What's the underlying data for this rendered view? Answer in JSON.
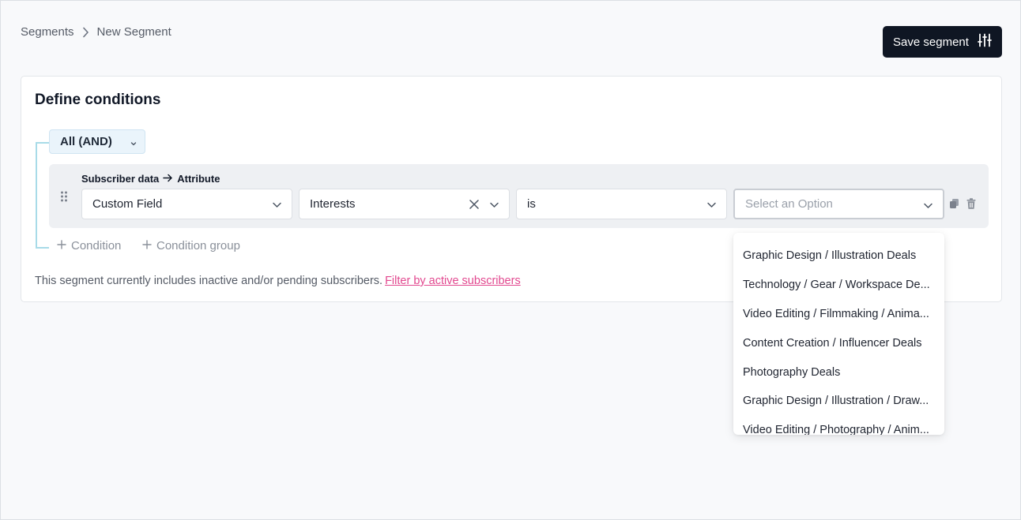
{
  "breadcrumb": {
    "parent": "Segments",
    "current": "New Segment"
  },
  "save_button": {
    "label": "Save segment",
    "icon": "sliders-icon"
  },
  "card": {
    "title": "Define conditions",
    "logic_operator": "All (AND)",
    "condition": {
      "source_label": "Subscriber data",
      "arrow": "→",
      "target_label": "Attribute",
      "field_type": "Custom Field",
      "field": "Interests",
      "operator": "is",
      "value_placeholder": "Select an Option"
    },
    "add_condition_label": "Condition",
    "add_group_label": "Condition group",
    "note": "This segment currently includes inactive and/or pending subscribers.",
    "note_link": "Filter by active subscribers"
  },
  "dropdown": {
    "options": [
      "Graphic Design / Illustration Deals",
      "Technology / Gear / Workspace De...",
      "Video Editing / Filmmaking / Anima...",
      "Content Creation / Influencer Deals",
      "Photography Deals",
      "Graphic Design / Illustration / Draw...",
      "Video Editing / Photography / Anim..."
    ]
  },
  "colors": {
    "accent_link": "#e2488f",
    "button_bg": "#0f1623",
    "tree_line": "#a8dbe8"
  }
}
